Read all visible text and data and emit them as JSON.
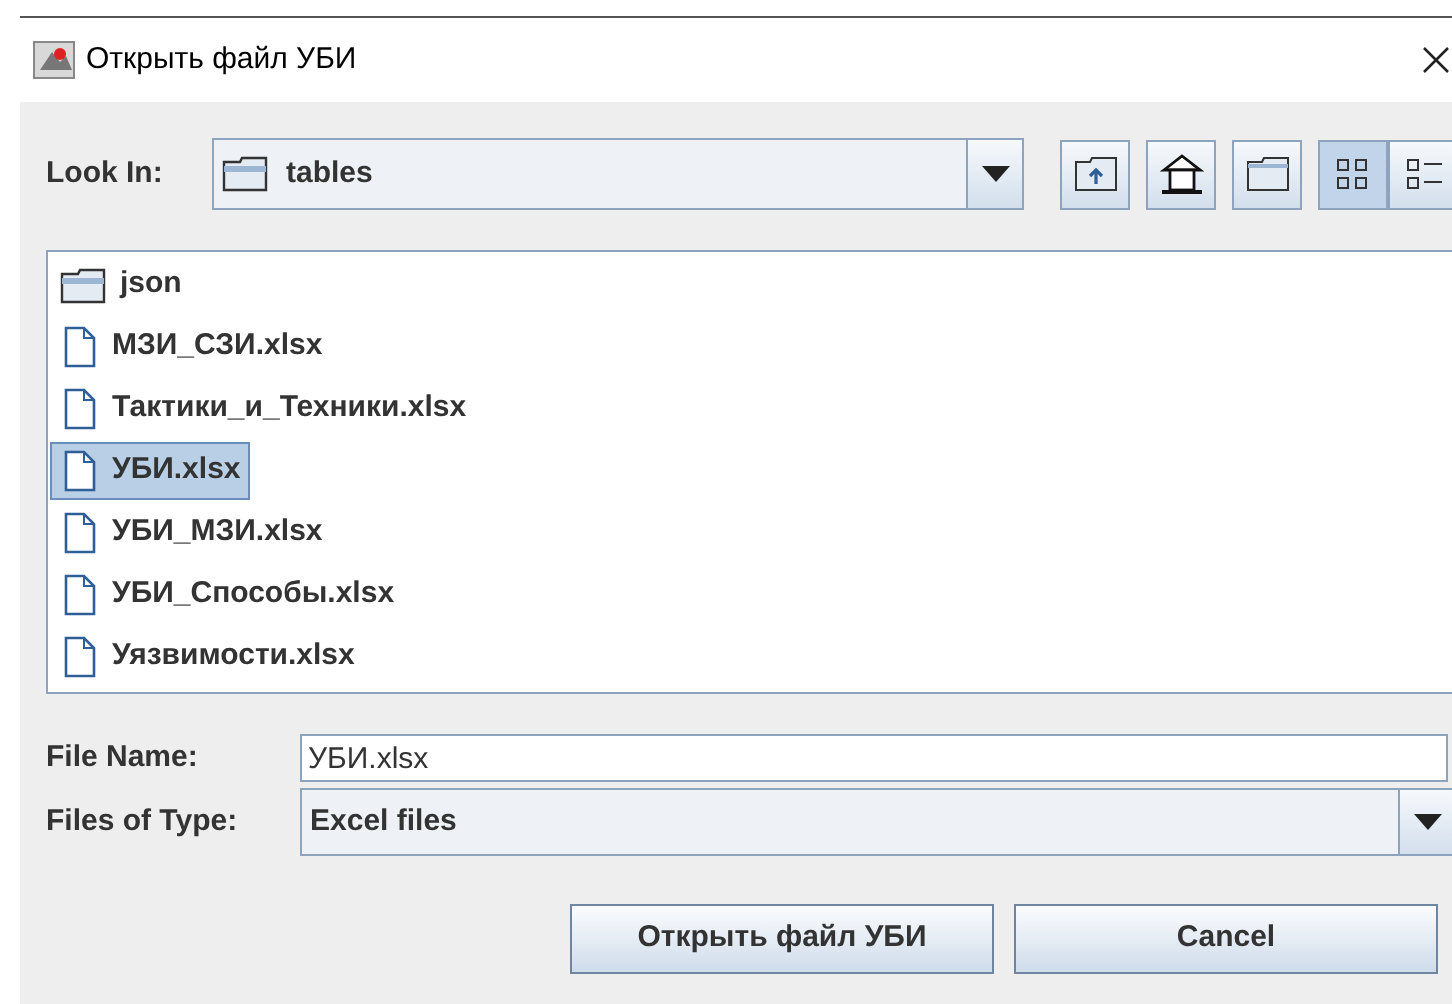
{
  "window": {
    "title": "Открыть файл УБИ"
  },
  "look_in": {
    "label": "Look In:",
    "value": "tables"
  },
  "toolbar": [
    {
      "kind": "up",
      "selected": false
    },
    {
      "kind": "home",
      "selected": false
    },
    {
      "kind": "new_folder",
      "selected": false
    },
    {
      "kind": "list",
      "selected": true
    },
    {
      "kind": "details",
      "selected": false
    }
  ],
  "files": [
    {
      "name": "json",
      "kind": "folder",
      "selected": false
    },
    {
      "name": "МЗИ_СЗИ.xlsx",
      "kind": "file",
      "selected": false
    },
    {
      "name": "Тактики_и_Техники.xlsx",
      "kind": "file",
      "selected": false
    },
    {
      "name": "УБИ.xlsx",
      "kind": "file",
      "selected": true
    },
    {
      "name": "УБИ_МЗИ.xlsx",
      "kind": "file",
      "selected": false
    },
    {
      "name": "УБИ_Способы.xlsx",
      "kind": "file",
      "selected": false
    },
    {
      "name": "Уязвимости.xlsx",
      "kind": "file",
      "selected": false
    }
  ],
  "file_name": {
    "label": "File Name:",
    "value": "УБИ.xlsx"
  },
  "files_of_type": {
    "label": "Files of Type:",
    "value": "Excel files"
  },
  "buttons": [
    "Открыть файл УБИ",
    "Cancel"
  ]
}
